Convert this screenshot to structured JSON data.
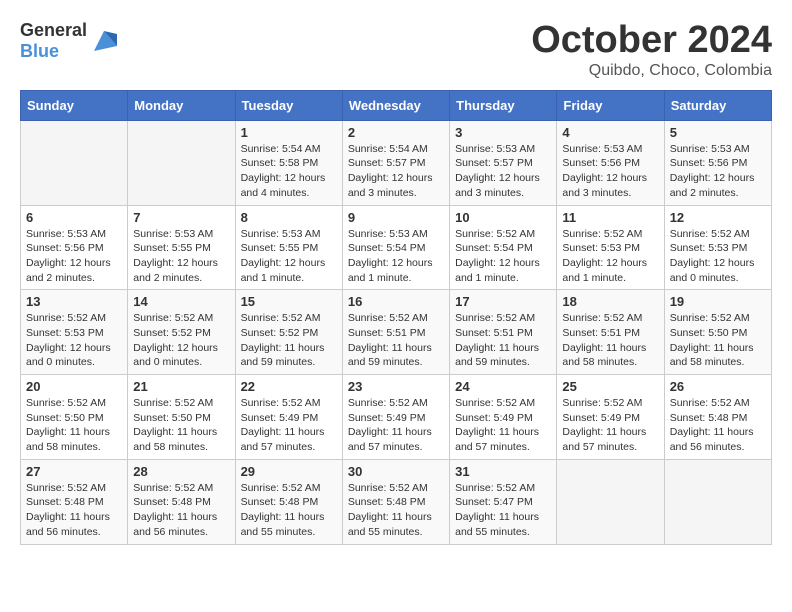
{
  "header": {
    "logo_general": "General",
    "logo_blue": "Blue",
    "month_title": "October 2024",
    "location": "Quibdo, Choco, Colombia"
  },
  "weekdays": [
    "Sunday",
    "Monday",
    "Tuesday",
    "Wednesday",
    "Thursday",
    "Friday",
    "Saturday"
  ],
  "weeks": [
    [
      {
        "day": "",
        "info": ""
      },
      {
        "day": "",
        "info": ""
      },
      {
        "day": "1",
        "info": "Sunrise: 5:54 AM\nSunset: 5:58 PM\nDaylight: 12 hours and 4 minutes."
      },
      {
        "day": "2",
        "info": "Sunrise: 5:54 AM\nSunset: 5:57 PM\nDaylight: 12 hours and 3 minutes."
      },
      {
        "day": "3",
        "info": "Sunrise: 5:53 AM\nSunset: 5:57 PM\nDaylight: 12 hours and 3 minutes."
      },
      {
        "day": "4",
        "info": "Sunrise: 5:53 AM\nSunset: 5:56 PM\nDaylight: 12 hours and 3 minutes."
      },
      {
        "day": "5",
        "info": "Sunrise: 5:53 AM\nSunset: 5:56 PM\nDaylight: 12 hours and 2 minutes."
      }
    ],
    [
      {
        "day": "6",
        "info": "Sunrise: 5:53 AM\nSunset: 5:56 PM\nDaylight: 12 hours and 2 minutes."
      },
      {
        "day": "7",
        "info": "Sunrise: 5:53 AM\nSunset: 5:55 PM\nDaylight: 12 hours and 2 minutes."
      },
      {
        "day": "8",
        "info": "Sunrise: 5:53 AM\nSunset: 5:55 PM\nDaylight: 12 hours and 1 minute."
      },
      {
        "day": "9",
        "info": "Sunrise: 5:53 AM\nSunset: 5:54 PM\nDaylight: 12 hours and 1 minute."
      },
      {
        "day": "10",
        "info": "Sunrise: 5:52 AM\nSunset: 5:54 PM\nDaylight: 12 hours and 1 minute."
      },
      {
        "day": "11",
        "info": "Sunrise: 5:52 AM\nSunset: 5:53 PM\nDaylight: 12 hours and 1 minute."
      },
      {
        "day": "12",
        "info": "Sunrise: 5:52 AM\nSunset: 5:53 PM\nDaylight: 12 hours and 0 minutes."
      }
    ],
    [
      {
        "day": "13",
        "info": "Sunrise: 5:52 AM\nSunset: 5:53 PM\nDaylight: 12 hours and 0 minutes."
      },
      {
        "day": "14",
        "info": "Sunrise: 5:52 AM\nSunset: 5:52 PM\nDaylight: 12 hours and 0 minutes."
      },
      {
        "day": "15",
        "info": "Sunrise: 5:52 AM\nSunset: 5:52 PM\nDaylight: 11 hours and 59 minutes."
      },
      {
        "day": "16",
        "info": "Sunrise: 5:52 AM\nSunset: 5:51 PM\nDaylight: 11 hours and 59 minutes."
      },
      {
        "day": "17",
        "info": "Sunrise: 5:52 AM\nSunset: 5:51 PM\nDaylight: 11 hours and 59 minutes."
      },
      {
        "day": "18",
        "info": "Sunrise: 5:52 AM\nSunset: 5:51 PM\nDaylight: 11 hours and 58 minutes."
      },
      {
        "day": "19",
        "info": "Sunrise: 5:52 AM\nSunset: 5:50 PM\nDaylight: 11 hours and 58 minutes."
      }
    ],
    [
      {
        "day": "20",
        "info": "Sunrise: 5:52 AM\nSunset: 5:50 PM\nDaylight: 11 hours and 58 minutes."
      },
      {
        "day": "21",
        "info": "Sunrise: 5:52 AM\nSunset: 5:50 PM\nDaylight: 11 hours and 58 minutes."
      },
      {
        "day": "22",
        "info": "Sunrise: 5:52 AM\nSunset: 5:49 PM\nDaylight: 11 hours and 57 minutes."
      },
      {
        "day": "23",
        "info": "Sunrise: 5:52 AM\nSunset: 5:49 PM\nDaylight: 11 hours and 57 minutes."
      },
      {
        "day": "24",
        "info": "Sunrise: 5:52 AM\nSunset: 5:49 PM\nDaylight: 11 hours and 57 minutes."
      },
      {
        "day": "25",
        "info": "Sunrise: 5:52 AM\nSunset: 5:49 PM\nDaylight: 11 hours and 57 minutes."
      },
      {
        "day": "26",
        "info": "Sunrise: 5:52 AM\nSunset: 5:48 PM\nDaylight: 11 hours and 56 minutes."
      }
    ],
    [
      {
        "day": "27",
        "info": "Sunrise: 5:52 AM\nSunset: 5:48 PM\nDaylight: 11 hours and 56 minutes."
      },
      {
        "day": "28",
        "info": "Sunrise: 5:52 AM\nSunset: 5:48 PM\nDaylight: 11 hours and 56 minutes."
      },
      {
        "day": "29",
        "info": "Sunrise: 5:52 AM\nSunset: 5:48 PM\nDaylight: 11 hours and 55 minutes."
      },
      {
        "day": "30",
        "info": "Sunrise: 5:52 AM\nSunset: 5:48 PM\nDaylight: 11 hours and 55 minutes."
      },
      {
        "day": "31",
        "info": "Sunrise: 5:52 AM\nSunset: 5:47 PM\nDaylight: 11 hours and 55 minutes."
      },
      {
        "day": "",
        "info": ""
      },
      {
        "day": "",
        "info": ""
      }
    ]
  ]
}
